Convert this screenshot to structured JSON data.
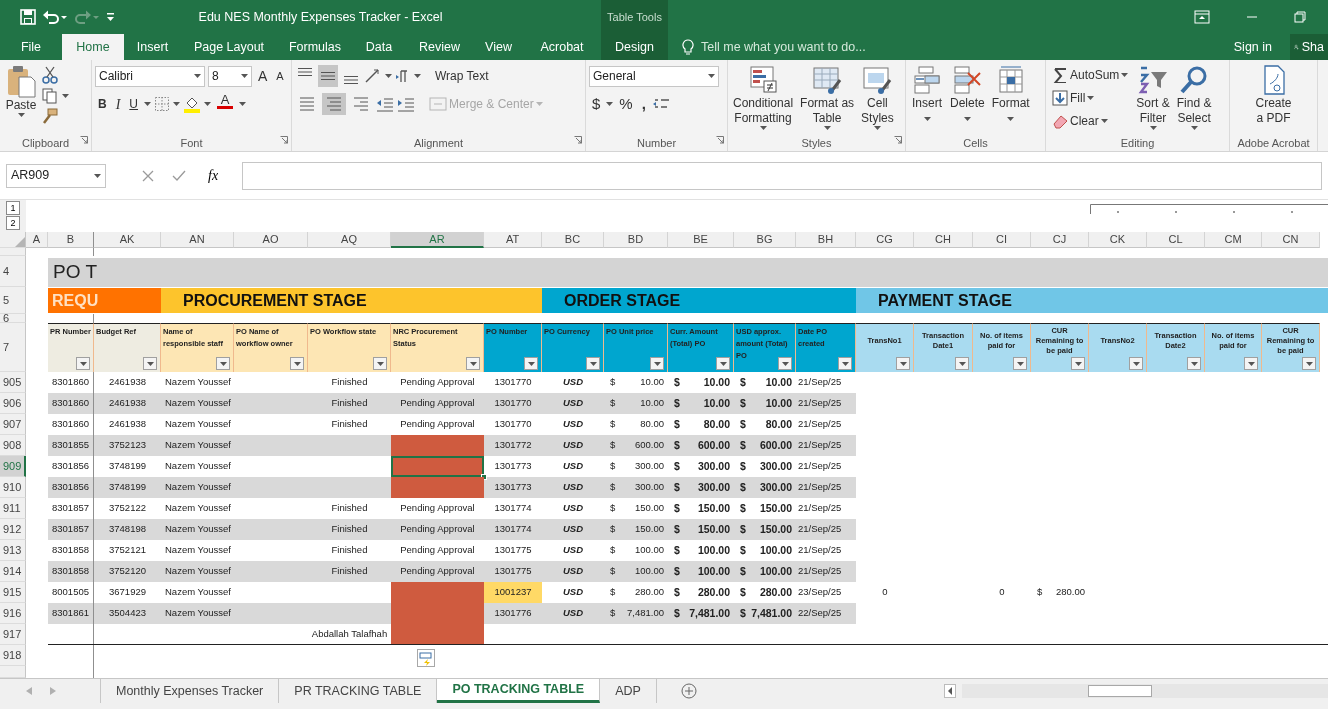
{
  "window": {
    "title": "Edu NES Monthly Expenses Tracker - Excel",
    "context_group": "Table Tools"
  },
  "ribbon_tabs": [
    {
      "label": "File",
      "selected": false,
      "kind": "main"
    },
    {
      "label": "Home",
      "selected": true,
      "kind": "main"
    },
    {
      "label": "Insert",
      "selected": false,
      "kind": "main"
    },
    {
      "label": "Page Layout",
      "selected": false,
      "kind": "main"
    },
    {
      "label": "Formulas",
      "selected": false,
      "kind": "main"
    },
    {
      "label": "Data",
      "selected": false,
      "kind": "main"
    },
    {
      "label": "Review",
      "selected": false,
      "kind": "main"
    },
    {
      "label": "View",
      "selected": false,
      "kind": "main"
    },
    {
      "label": "Acrobat",
      "selected": false,
      "kind": "main"
    },
    {
      "label": "Design",
      "selected": false,
      "kind": "context"
    }
  ],
  "tell_me": {
    "placeholder": "Tell me what you want to do..."
  },
  "account": {
    "sign_in": "Sign in",
    "share": "Sha"
  },
  "ribbon": {
    "clipboard": {
      "label": "Clipboard",
      "paste": "Paste"
    },
    "font": {
      "label": "Font",
      "name": "Calibri",
      "size": "8",
      "grow": "A",
      "shrink": "A",
      "bold": "B",
      "italic": "I",
      "underline": "U",
      "font_color": "A"
    },
    "alignment": {
      "label": "Alignment",
      "wrap_text": "Wrap Text",
      "merge": "Merge & Center",
      "merge_disabled": true,
      "vertical": [
        {
          "selected": false
        },
        {
          "selected": true
        },
        {
          "selected": false
        }
      ],
      "horizontal": [
        {
          "selected": false
        },
        {
          "selected": true
        },
        {
          "selected": false
        }
      ]
    },
    "number": {
      "label": "Number",
      "format": "General",
      "currency": "$",
      "percent": "%",
      "comma": ","
    },
    "styles": {
      "label": "Styles",
      "buttons": [
        [
          "Conditional",
          "Formatting"
        ],
        [
          "Format as",
          "Table"
        ],
        [
          "Cell",
          "Styles"
        ]
      ]
    },
    "cells": {
      "label": "Cells",
      "buttons": [
        "Insert",
        "Delete",
        "Format"
      ]
    },
    "editing": {
      "label": "Editing",
      "small": [
        "AutoSum",
        "Fill",
        "Clear"
      ],
      "large": [
        [
          "Sort &",
          "Filter"
        ],
        [
          "Find &",
          "Select"
        ]
      ]
    },
    "acrobat": {
      "label": "Adobe Acrobat",
      "buttons": [
        [
          "Create",
          "a PDF"
        ]
      ]
    }
  },
  "formula_bar": {
    "name_box": "AR909",
    "function_button": "fx"
  },
  "outline_levels": [
    "1",
    "2"
  ],
  "columns": [
    {
      "letter": "A",
      "selected": false,
      "kind": "blank"
    },
    {
      "letter": "B",
      "selected": false,
      "kind": "right"
    },
    {
      "letter": "AK",
      "selected": false,
      "kind": "center"
    },
    {
      "letter": "AN",
      "selected": false,
      "kind": "left"
    },
    {
      "letter": "AO",
      "selected": false,
      "kind": "left"
    },
    {
      "letter": "AQ",
      "selected": false,
      "kind": "center"
    },
    {
      "letter": "AR",
      "selected": true,
      "kind": "center"
    },
    {
      "letter": "AT",
      "selected": false,
      "kind": "center"
    },
    {
      "letter": "BC",
      "selected": false,
      "kind": "code"
    },
    {
      "letter": "BD",
      "selected": false,
      "kind": "money"
    },
    {
      "letter": "BE",
      "selected": false,
      "kind": "money-bold"
    },
    {
      "letter": "BG",
      "selected": false,
      "kind": "money-bold"
    },
    {
      "letter": "BH",
      "selected": false,
      "kind": "date"
    },
    {
      "letter": "CG",
      "selected": false,
      "kind": "center"
    },
    {
      "letter": "CH",
      "selected": false,
      "kind": "center"
    },
    {
      "letter": "CI",
      "selected": false,
      "kind": "center"
    },
    {
      "letter": "CJ",
      "selected": false,
      "kind": "money"
    },
    {
      "letter": "CK",
      "selected": false,
      "kind": "center"
    },
    {
      "letter": "CL",
      "selected": false,
      "kind": "center"
    },
    {
      "letter": "CM",
      "selected": false,
      "kind": "center"
    },
    {
      "letter": "CN",
      "selected": false,
      "kind": "center"
    }
  ],
  "sheet": {
    "row_labels": {
      "title": "4",
      "stages": "5",
      "spacer": "6",
      "headers": "7"
    },
    "title": "PO T",
    "stages": [
      {
        "label": "REQU",
        "color": "#ff7200",
        "kind": "inverse"
      },
      {
        "label": "PROCUREMENT STAGE",
        "color": "#fdc42c",
        "kind": "plain"
      },
      {
        "label": "ORDER STAGE",
        "color": "#00a6cf",
        "kind": "plain"
      },
      {
        "label": "PAYMENT STAGE",
        "color": "#70c6e7",
        "kind": "plain"
      }
    ],
    "headers": [
      {
        "label": "PR Number",
        "color": "#eeece1",
        "kind": "top"
      },
      {
        "label": "Budget Ref",
        "color": "#eeece1",
        "kind": "top"
      },
      {
        "label": "Name of responsible staff",
        "color": "#fde6b4",
        "kind": "top"
      },
      {
        "label": "PO Name of workflow owner",
        "color": "#fde6b4",
        "kind": "top"
      },
      {
        "label": "PO Workflow state",
        "color": "#fde6b4",
        "kind": "top"
      },
      {
        "label": "NRC Procurement Status",
        "color": "#fde6b4",
        "kind": "top"
      },
      {
        "label": "PO Number",
        "color": "#00a6cf",
        "kind": "top"
      },
      {
        "label": "PO Currency",
        "color": "#00a6cf",
        "kind": "top"
      },
      {
        "label": "PO Unit price",
        "color": "#00a6cf",
        "kind": "top"
      },
      {
        "label": "Curr. Amount (Total) PO",
        "color": "#00a6cf",
        "kind": "top"
      },
      {
        "label": "USD approx. amount (Total) PO",
        "color": "#00a6cf",
        "kind": "top"
      },
      {
        "label": "Date PO created",
        "color": "#00a6cf",
        "kind": "top"
      },
      {
        "label": "TransNo1",
        "color": "#a9dbf0",
        "kind": "middle"
      },
      {
        "label": "Transaction Date1",
        "color": "#a9dbf0",
        "kind": "middle"
      },
      {
        "label": "No. of items paid for",
        "color": "#a9dbf0",
        "kind": "middle"
      },
      {
        "label": "CUR Remaining to be paid",
        "color": "#a9dbf0",
        "kind": "middle"
      },
      {
        "label": "TransNo2",
        "color": "#a9dbf0",
        "kind": "middle"
      },
      {
        "label": "Transaction Date2",
        "color": "#a9dbf0",
        "kind": "middle"
      },
      {
        "label": "No. of items paid for",
        "color": "#a9dbf0",
        "kind": "middle"
      },
      {
        "label": "CUR Remaining to be paid",
        "color": "#a9dbf0",
        "kind": "middle"
      }
    ],
    "rows": [
      {
        "number": "905",
        "selected": false,
        "shaded": false,
        "cells": [
          "8301860",
          "2461938",
          "Nazem Youssef",
          null,
          "Finished",
          "Pending Approval",
          "1301770",
          "USD",
          {
            "sign": "$",
            "amount": "10.00"
          },
          {
            "sign": "$",
            "amount": "10.00"
          },
          {
            "sign": "$",
            "amount": "10.00"
          },
          "21/Sep/25"
        ]
      },
      {
        "number": "906",
        "selected": false,
        "shaded": true,
        "cells": [
          "8301860",
          "2461938",
          "Nazem Youssef",
          null,
          "Finished",
          "Pending Approval",
          "1301770",
          "USD",
          {
            "sign": "$",
            "amount": "10.00"
          },
          {
            "sign": "$",
            "amount": "10.00"
          },
          {
            "sign": "$",
            "amount": "10.00"
          },
          "21/Sep/25"
        ]
      },
      {
        "number": "907",
        "selected": false,
        "shaded": false,
        "cells": [
          "8301860",
          "2461938",
          "Nazem Youssef",
          null,
          "Finished",
          "Pending Approval",
          "1301770",
          "USD",
          {
            "sign": "$",
            "amount": "80.00"
          },
          {
            "sign": "$",
            "amount": "80.00"
          },
          {
            "sign": "$",
            "amount": "80.00"
          },
          "21/Sep/25"
        ]
      },
      {
        "number": "908",
        "selected": false,
        "shaded": true,
        "cells": [
          "8301855",
          "3752123",
          "Nazem Youssef",
          null,
          null,
          {
            "color": "#cf5b3f"
          },
          "1301772",
          "USD",
          {
            "sign": "$",
            "amount": "600.00"
          },
          {
            "sign": "$",
            "amount": "600.00"
          },
          {
            "sign": "$",
            "amount": "600.00"
          },
          "21/Sep/25"
        ]
      },
      {
        "number": "909",
        "selected": true,
        "shaded": false,
        "cells": [
          "8301856",
          "3748199",
          "Nazem Youssef",
          null,
          null,
          {
            "color": "#cf5b3f"
          },
          "1301773",
          "USD",
          {
            "sign": "$",
            "amount": "300.00"
          },
          {
            "sign": "$",
            "amount": "300.00"
          },
          {
            "sign": "$",
            "amount": "300.00"
          },
          "21/Sep/25"
        ]
      },
      {
        "number": "910",
        "selected": false,
        "shaded": true,
        "cells": [
          "8301856",
          "3748199",
          "Nazem Youssef",
          null,
          null,
          {
            "color": "#cf5b3f"
          },
          "1301773",
          "USD",
          {
            "sign": "$",
            "amount": "300.00"
          },
          {
            "sign": "$",
            "amount": "300.00"
          },
          {
            "sign": "$",
            "amount": "300.00"
          },
          "21/Sep/25"
        ]
      },
      {
        "number": "911",
        "selected": false,
        "shaded": false,
        "cells": [
          "8301857",
          "3752122",
          "Nazem Youssef",
          null,
          "Finished",
          "Pending Approval",
          "1301774",
          "USD",
          {
            "sign": "$",
            "amount": "150.00"
          },
          {
            "sign": "$",
            "amount": "150.00"
          },
          {
            "sign": "$",
            "amount": "150.00"
          },
          "21/Sep/25"
        ]
      },
      {
        "number": "912",
        "selected": false,
        "shaded": true,
        "cells": [
          "8301857",
          "3748198",
          "Nazem Youssef",
          null,
          "Finished",
          "Pending Approval",
          "1301774",
          "USD",
          {
            "sign": "$",
            "amount": "150.00"
          },
          {
            "sign": "$",
            "amount": "150.00"
          },
          {
            "sign": "$",
            "amount": "150.00"
          },
          "21/Sep/25"
        ]
      },
      {
        "number": "913",
        "selected": false,
        "shaded": false,
        "cells": [
          "8301858",
          "3752121",
          "Nazem Youssef",
          null,
          "Finished",
          "Pending Approval",
          "1301775",
          "USD",
          {
            "sign": "$",
            "amount": "100.00"
          },
          {
            "sign": "$",
            "amount": "100.00"
          },
          {
            "sign": "$",
            "amount": "100.00"
          },
          "21/Sep/25"
        ]
      },
      {
        "number": "914",
        "selected": false,
        "shaded": true,
        "cells": [
          "8301858",
          "3752120",
          "Nazem Youssef",
          null,
          "Finished",
          "Pending Approval",
          "1301775",
          "USD",
          {
            "sign": "$",
            "amount": "100.00"
          },
          {
            "sign": "$",
            "amount": "100.00"
          },
          {
            "sign": "$",
            "amount": "100.00"
          },
          "21/Sep/25"
        ]
      },
      {
        "number": "915",
        "selected": false,
        "shaded": false,
        "cells": [
          "8001505",
          "3671929",
          "Nazem Youssef",
          null,
          null,
          {
            "color": "#cf5b3f"
          },
          {
            "text": "1001237",
            "color": "#ffd966"
          },
          "USD",
          {
            "sign": "$",
            "amount": "280.00"
          },
          {
            "sign": "$",
            "amount": "280.00"
          },
          {
            "sign": "$",
            "amount": "280.00"
          },
          "23/Sep/25",
          "0",
          null,
          "0",
          {
            "sign": "$",
            "amount": "280.00"
          }
        ]
      },
      {
        "number": "916",
        "selected": false,
        "shaded": true,
        "cells": [
          "8301861",
          "3504423",
          "Nazem Youssef",
          null,
          null,
          {
            "color": "#cf5b3f"
          },
          "1301776",
          "USD",
          {
            "sign": "$",
            "amount": "7,481.00"
          },
          {
            "sign": "$",
            "amount": "7,481.00"
          },
          {
            "sign": "$",
            "amount": "7,481.00"
          },
          "22/Sep/25"
        ]
      },
      {
        "number": "917",
        "selected": false,
        "shaded": false,
        "cells": [
          null,
          null,
          null,
          null,
          "Abdallah Talafhah",
          {
            "color": "#cf5b3f"
          }
        ]
      }
    ],
    "extra_rows": [
      "918"
    ]
  },
  "sheet_tabs": [
    {
      "label": "Monthly Expenses Tracker",
      "selected": false
    },
    {
      "label": "PR TRACKING TABLE",
      "selected": false
    },
    {
      "label": "PO TRACKING TABLE",
      "selected": true
    },
    {
      "label": "ADP",
      "selected": false
    }
  ]
}
